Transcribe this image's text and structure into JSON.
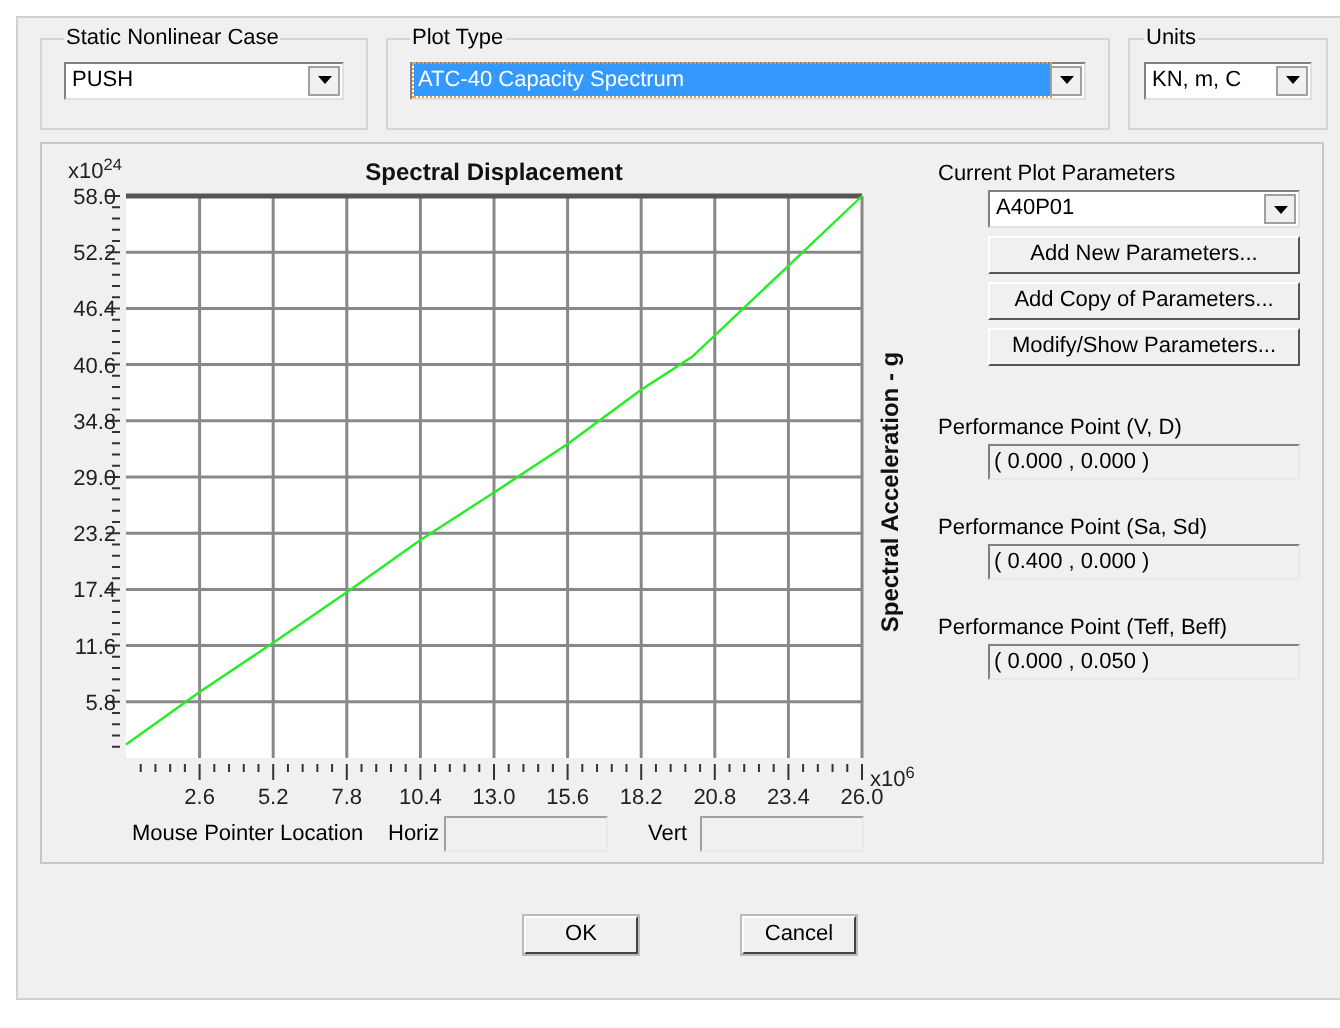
{
  "static_nonlinear_case": {
    "label": "Static Nonlinear Case",
    "value": "PUSH"
  },
  "plot_type": {
    "label": "Plot Type",
    "value": "ATC-40 Capacity Spectrum",
    "selected": true
  },
  "units": {
    "label": "Units",
    "value": "KN, m, C"
  },
  "chart": {
    "x_multiplier": "x10$^{6}$",
    "y_multiplier": "x10$^{24}$",
    "chart_data": {
      "type": "line",
      "title": "Spectral Displacement",
      "ylabel": "Spectral Acceleration - g",
      "xlim": [
        0,
        26
      ],
      "ylim": [
        0,
        58
      ],
      "grid": true,
      "xticks": [
        2.6,
        5.2,
        7.8,
        10.4,
        {
          "value": 13,
          "label": "13.0"
        },
        15.6,
        18.2,
        20.8,
        23.4,
        {
          "value": 26,
          "label": "26.0"
        }
      ],
      "yticks": [
        5.8,
        11.6,
        17.4,
        23.2,
        {
          "value": 29,
          "label": "29.0"
        },
        34.8,
        40.6,
        46.4,
        52.2,
        {
          "value": 58,
          "label": "58.0"
        }
      ],
      "x": [
        0,
        2.6,
        5.2,
        7.8,
        10.4,
        13,
        15.6,
        18.2,
        20,
        23.4,
        26
      ],
      "series": [
        {
          "color": "#22ee22",
          "values": [
            1.4,
            6.8,
            11.9,
            17.1,
            22.5,
            27.4,
            32.4,
            38.0,
            41.4,
            50.8,
            58
          ]
        }
      ]
    }
  },
  "mouse_pointer": {
    "label": "Mouse Pointer Location",
    "horiz_label": "Horiz",
    "vert_label": "Vert"
  },
  "current_plot_parameters": {
    "label": "Current Plot Parameters",
    "value": "A40P01"
  },
  "parameter_buttons": [
    "Add New Parameters...",
    "Add Copy of Parameters...",
    "Modify/Show Parameters..."
  ],
  "performance_points": [
    {
      "label": "Performance Point (V, D)",
      "value": "( 0.000 , 0.000 )"
    },
    {
      "label": "Performance Point (Sa, Sd)",
      "value": "( 0.400 , 0.000 )"
    },
    {
      "label": "Performance Point (Teff, Beff)",
      "value": "( 0.000 , 0.050 )"
    }
  ],
  "buttons": [
    "OK",
    "Cancel"
  ]
}
